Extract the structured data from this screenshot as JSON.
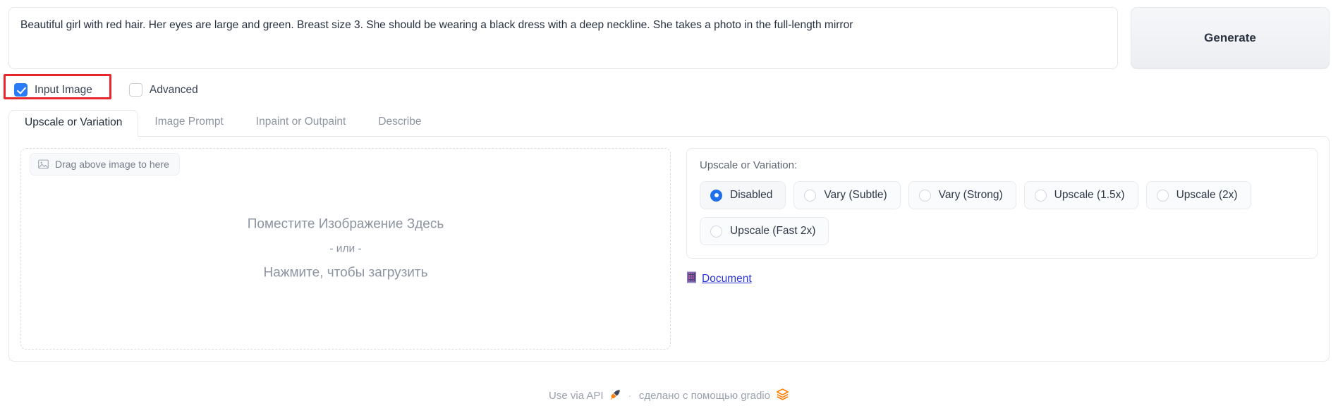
{
  "prompt": {
    "value": "Beautiful girl with red hair. Her eyes are large and green. Breast size 3. She should be wearing a black dress with a deep neckline. She takes a photo in the full-length mirror",
    "placeholder": ""
  },
  "generate": {
    "label": "Generate"
  },
  "checkboxes": [
    {
      "label": "Input Image",
      "checked": true,
      "highlighted": true
    },
    {
      "label": "Advanced",
      "checked": false,
      "highlighted": false
    }
  ],
  "tabs": [
    {
      "label": "Upscale or Variation",
      "active": true
    },
    {
      "label": "Image Prompt",
      "active": false
    },
    {
      "label": "Inpaint or Outpaint",
      "active": false
    },
    {
      "label": "Describe",
      "active": false
    }
  ],
  "dropzone": {
    "chip_label": "Drag above image to here",
    "chip_icon": "image-icon",
    "line1": "Поместите Изображение Здесь",
    "line2": "- или -",
    "line3": "Нажмите, чтобы загрузить"
  },
  "upscale": {
    "label": "Upscale or Variation:",
    "options": [
      {
        "label": "Disabled",
        "selected": true
      },
      {
        "label": "Vary (Subtle)",
        "selected": false
      },
      {
        "label": "Vary (Strong)",
        "selected": false
      },
      {
        "label": "Upscale (1.5x)",
        "selected": false
      },
      {
        "label": "Upscale (2x)",
        "selected": false
      },
      {
        "label": "Upscale (Fast 2x)",
        "selected": false
      }
    ],
    "doc_link": {
      "label": "Document",
      "icon": "office-building-emoji"
    }
  },
  "footer": {
    "api_label": "Use via API",
    "api_icon": "rocket-emoji",
    "separator": "·",
    "built_with": "сделано с помощью gradio",
    "gradio_icon": "gradio-logo"
  },
  "colors": {
    "accent_blue": "#2a7bf6",
    "radio_blue": "#1f6feb",
    "highlight_red": "#e8262b",
    "link_blue": "#2a35d6",
    "gradio_orange": "#ff7c00"
  }
}
